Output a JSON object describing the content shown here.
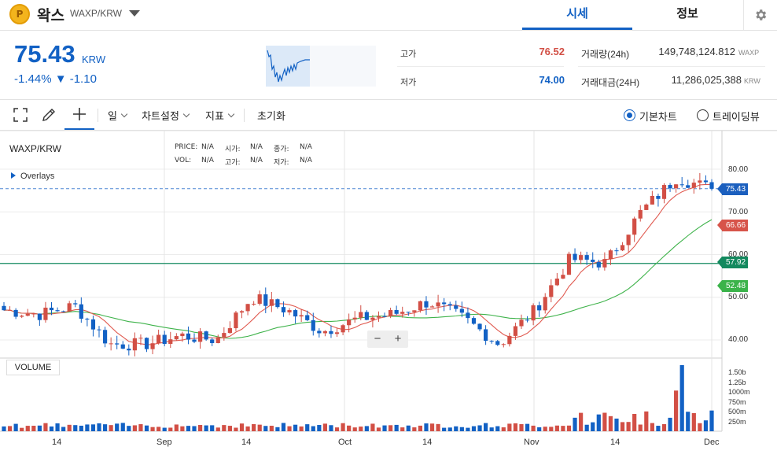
{
  "header": {
    "coin_logo_glyph": "P",
    "coin_name": "왁스",
    "pair": "WAXP/KRW",
    "tabs": [
      {
        "label": "시세",
        "active": true
      },
      {
        "label": "정보",
        "active": false
      }
    ]
  },
  "summary": {
    "price": "75.43",
    "unit": "KRW",
    "change_pct": "-1.44%",
    "change_abs": "▼ -1.10",
    "high_label": "고가",
    "high_value": "76.52",
    "low_label": "저가",
    "low_value": "74.00",
    "volume_label": "거래량(24h)",
    "volume_value": "149,748,124.812",
    "volume_unit": "WAXP",
    "amount_label": "거래대금(24H)",
    "amount_value": "11,286,025,388",
    "amount_unit": "KRW"
  },
  "toolbar": {
    "interval": "일",
    "chart_settings": "차트설정",
    "indicators": "지표",
    "reset": "초기화",
    "view_basic": "기본차트",
    "view_trading": "트레이딩뷰",
    "selected_view": "기본차트"
  },
  "chart": {
    "symbol": "WAXP/KRW",
    "legend": {
      "price_label": "PRICE:",
      "price_val": "N/A",
      "open_label": "시가:",
      "open_val": "N/A",
      "close_label": "종가:",
      "close_val": "N/A",
      "vol_label": "VOL:",
      "vol_val": "N/A",
      "high_label": "고가:",
      "high_val": "N/A",
      "low_label": "저가:",
      "low_val": "N/A"
    },
    "overlays_label": "Overlays",
    "volume_label": "VOLUME",
    "zoom_out": "−",
    "zoom_in": "+",
    "price_ticks": [
      "80.00",
      "70.00",
      "60.00",
      "50.00",
      "40.00"
    ],
    "volume_ticks": [
      "1.50b",
      "1.25b",
      "1000m",
      "750m",
      "500m",
      "250m"
    ],
    "x_ticks": [
      "14",
      "Sep",
      "14",
      "Oct",
      "14",
      "Nov",
      "14",
      "Dec"
    ],
    "markers": {
      "last_price": "75.43",
      "ma_red": "66.66",
      "horizontal_line": "57.92",
      "ma_green": "52.48"
    },
    "colors": {
      "up": "#d24f45",
      "down": "#1261c4",
      "ma_short": "#e05a50",
      "ma_long": "#3fb34b",
      "hline": "#13895e"
    }
  },
  "chart_data": {
    "type": "candlestick",
    "symbol": "WAXP/KRW",
    "y_unit": "KRW",
    "ylim": [
      35,
      88
    ],
    "close_series_approx": [
      {
        "date": "Aug 5",
        "close": 47
      },
      {
        "date": "Aug 14",
        "close": 46
      },
      {
        "date": "Aug 23",
        "close": 48
      },
      {
        "date": "Sep 1",
        "close": 39
      },
      {
        "date": "Sep 10",
        "close": 39
      },
      {
        "date": "Sep 14",
        "close": 41
      },
      {
        "date": "Sep 20",
        "close": 40
      },
      {
        "date": "Sep 26",
        "close": 50
      },
      {
        "date": "Oct 1",
        "close": 47
      },
      {
        "date": "Oct 5",
        "close": 42
      },
      {
        "date": "Oct 14",
        "close": 45
      },
      {
        "date": "Oct 20",
        "close": 46
      },
      {
        "date": "Oct 26",
        "close": 49
      },
      {
        "date": "Nov 1",
        "close": 45
      },
      {
        "date": "Nov 6",
        "close": 39
      },
      {
        "date": "Nov 12",
        "close": 47
      },
      {
        "date": "Nov 16",
        "close": 59
      },
      {
        "date": "Nov 22",
        "close": 58
      },
      {
        "date": "Nov 26",
        "close": 70
      },
      {
        "date": "Nov 28",
        "close": 78
      },
      {
        "date": "Dec 1",
        "close": 75.43
      }
    ],
    "moving_averages": [
      {
        "color": "red",
        "last": 66.66
      },
      {
        "color": "green",
        "last": 52.48
      }
    ],
    "horizontal_line": 57.92
  }
}
